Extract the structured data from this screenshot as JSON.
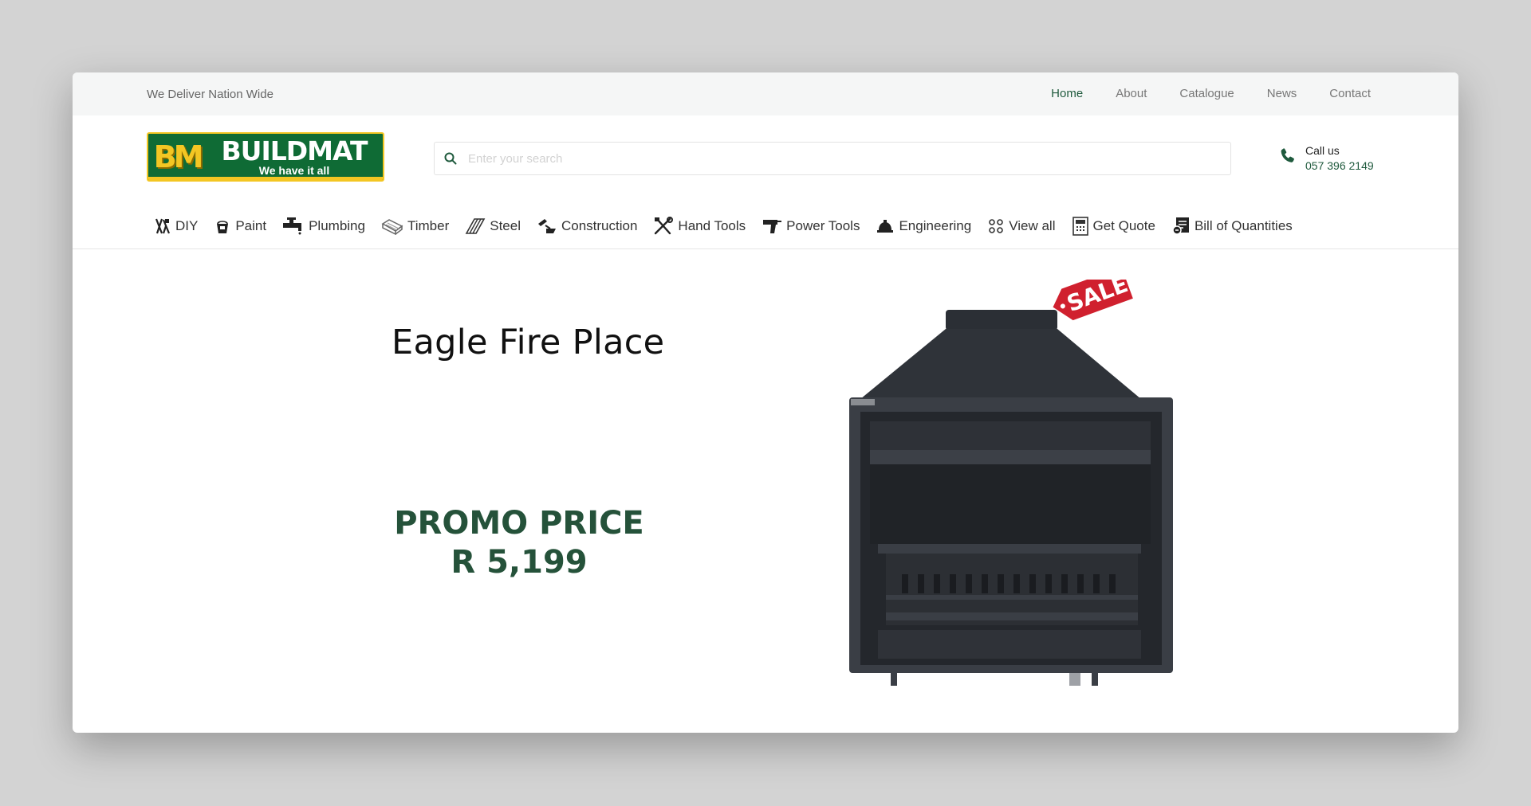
{
  "topbar": {
    "tagline": "We Deliver Nation Wide",
    "nav": [
      {
        "label": "Home",
        "active": true
      },
      {
        "label": "About",
        "active": false
      },
      {
        "label": "Catalogue",
        "active": false
      },
      {
        "label": "News",
        "active": false
      },
      {
        "label": "Contact",
        "active": false
      }
    ]
  },
  "header": {
    "logo": {
      "mark": "BM",
      "brand": "BUILDMAT",
      "slogan": "We have it all"
    },
    "search": {
      "placeholder": "Enter your search",
      "value": ""
    },
    "call": {
      "label": "Call us",
      "number": "057 396 2149"
    }
  },
  "categories": [
    {
      "label": "DIY",
      "icon": "diy-icon"
    },
    {
      "label": "Paint",
      "icon": "paint-bucket-icon"
    },
    {
      "label": "Plumbing",
      "icon": "tap-icon"
    },
    {
      "label": "Timber",
      "icon": "timber-icon"
    },
    {
      "label": "Steel",
      "icon": "steel-icon"
    },
    {
      "label": "Construction",
      "icon": "trowel-icon"
    },
    {
      "label": "Hand Tools",
      "icon": "tools-icon"
    },
    {
      "label": "Power Tools",
      "icon": "drill-icon"
    },
    {
      "label": "Engineering",
      "icon": "hard-hat-icon"
    },
    {
      "label": "View all",
      "icon": "grid-dots-icon"
    },
    {
      "label": "Get Quote",
      "icon": "calculator-icon"
    },
    {
      "label": "Bill of Quantities",
      "icon": "document-icon"
    }
  ],
  "hero": {
    "title": "Eagle Fire Place",
    "promo_label": "PROMO PRICE",
    "price": "R 5,199",
    "sale_tag": "SALE"
  },
  "colors": {
    "brand_green": "#1f5a3d",
    "logo_green": "#0f6b35",
    "logo_yellow": "#f3c623",
    "sale_red": "#d0202e"
  }
}
